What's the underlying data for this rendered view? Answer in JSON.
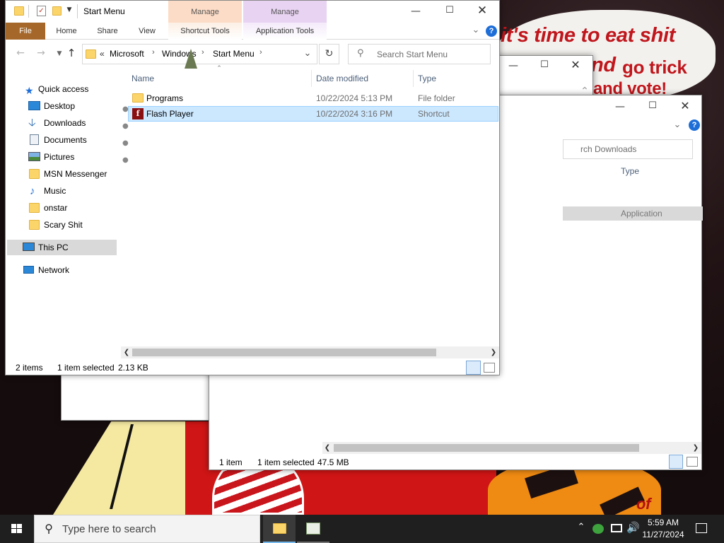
{
  "wallpaper": {
    "line1": "it's time to eat shit",
    "line2": "nd",
    "line2b": "go trick",
    "line3": "and vote!",
    "corner": "of"
  },
  "main_window": {
    "title": "Start Menu",
    "ribbon": {
      "file": "File",
      "home": "Home",
      "share": "Share",
      "view": "View",
      "manage1": "Manage",
      "manage1_group": "Shortcut Tools",
      "manage2": "Manage",
      "manage2_group": "Application Tools"
    },
    "address": {
      "overflow": "«",
      "segments": [
        "Microsoft",
        "Windows",
        "Start Menu"
      ]
    },
    "search_placeholder": "Search Start Menu",
    "nav": {
      "quick_access": "Quick access",
      "items": [
        "Desktop",
        "Downloads",
        "Documents",
        "Pictures",
        "MSN Messenger",
        "Music",
        "onstar",
        "Scary Shit"
      ],
      "this_pc": "This PC",
      "network": "Network"
    },
    "columns": {
      "name": "Name",
      "date": "Date modified",
      "type": "Type"
    },
    "rows": [
      {
        "name": "Programs",
        "date": "10/22/2024 5:13 PM",
        "type": "File folder"
      },
      {
        "name": "Flash Player",
        "date": "10/22/2024 3:16 PM",
        "type": "Shortcut"
      }
    ],
    "status": {
      "items": "2 items",
      "selected": "1 item selected",
      "size": "2.13 KB"
    }
  },
  "back_window2": {
    "search_fragment": "rch Downloads",
    "type_header": "Type",
    "row_type": "Application",
    "status": {
      "items": "1 item",
      "selected": "1 item selected",
      "size": "47.5 MB"
    }
  },
  "taskbar": {
    "search_placeholder": "Type here to search",
    "time": "5:59 AM",
    "date": "11/27/2024"
  },
  "colors": {
    "file_tab": "#a5682a",
    "manage1_tint": "#fcdcc6",
    "manage2_tint": "#e8d3f2",
    "selection": "#cce8ff",
    "taskbar": "#1f1f1f",
    "accent": "#1e6ed8"
  }
}
